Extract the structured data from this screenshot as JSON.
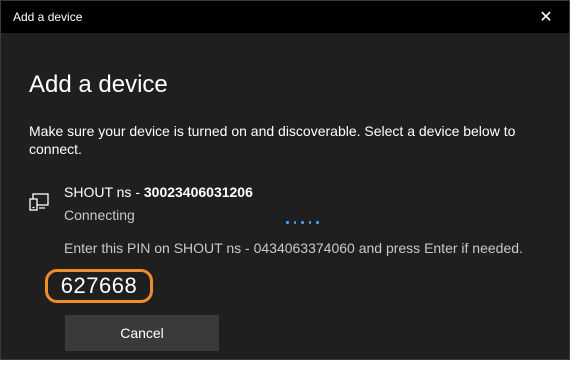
{
  "window": {
    "title": "Add a device",
    "close_glyph": "✕"
  },
  "heading": "Add a device",
  "description": "Make sure your device is turned on and discoverable. Select a device below to connect.",
  "device": {
    "icon": "computer-phone-icon",
    "name_prefix": "SHOUT ns - ",
    "name_id": "30023406031206",
    "status": "Connecting",
    "pin_instructions": "Enter this PIN on SHOUT ns - 0434063374060 and press Enter if needed.",
    "pin": "627668"
  },
  "cancel_label": "Cancel",
  "colors": {
    "background": "#1f1f1f",
    "titlebar": "#000000",
    "highlight": "#f28c28",
    "progress": "#4aa3ff",
    "button": "#3a3a3a"
  }
}
